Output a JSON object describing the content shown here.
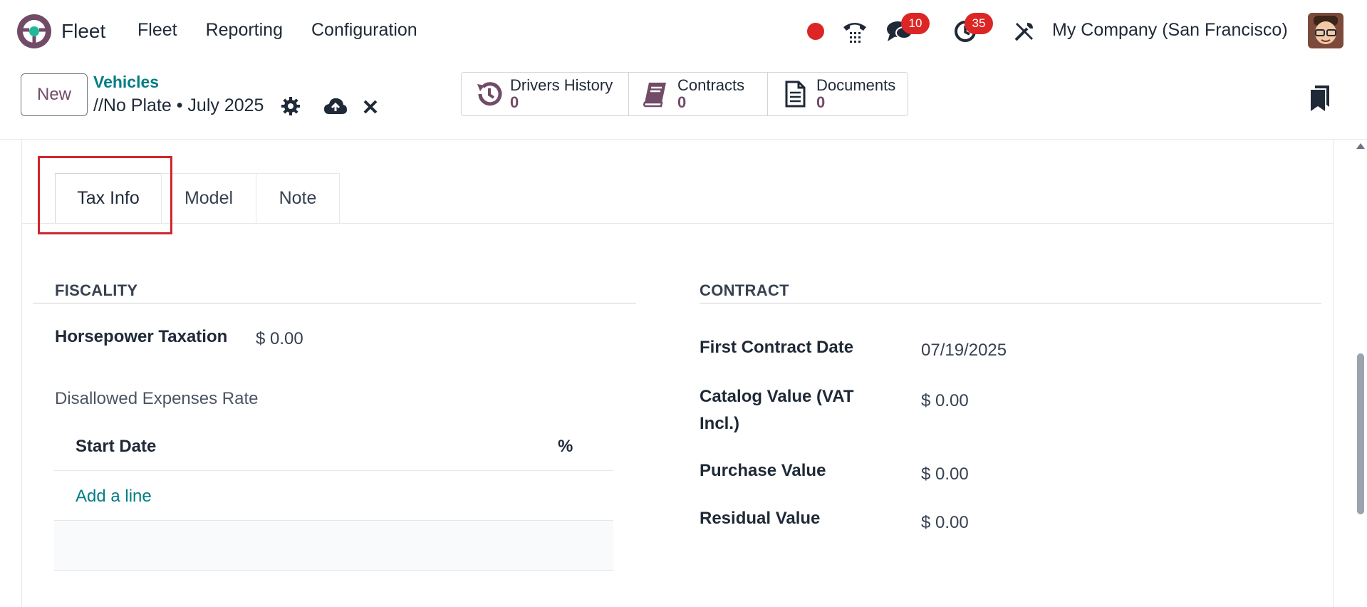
{
  "app": {
    "name": "Fleet",
    "menu": [
      "Fleet",
      "Reporting",
      "Configuration"
    ],
    "company": "My Company (San Francisco)",
    "chat_badge": "10",
    "activity_badge": "35"
  },
  "control_panel": {
    "new_label": "New",
    "breadcrumb_parent": "Vehicles",
    "breadcrumb_current": "//No Plate • July 2025",
    "stats": [
      {
        "label": "Drivers History",
        "value": "0"
      },
      {
        "label": "Contracts",
        "value": "0"
      },
      {
        "label": "Documents",
        "value": "0"
      }
    ]
  },
  "tabs": [
    "Tax Info",
    "Model",
    "Note"
  ],
  "fiscality": {
    "title": "FISCALITY",
    "horsepower_label": "Horsepower Taxation",
    "horsepower_value": "$ 0.00",
    "disallowed_label": "Disallowed Expenses Rate",
    "table_headers": [
      "Start Date",
      "%"
    ],
    "add_line": "Add a line"
  },
  "contract": {
    "title": "CONTRACT",
    "fields": [
      {
        "label": "First Contract Date",
        "value": "07/19/2025"
      },
      {
        "label": "Catalog Value (VAT Incl.)",
        "value": "$ 0.00"
      },
      {
        "label": "Purchase Value",
        "value": "$ 0.00"
      },
      {
        "label": "Residual Value",
        "value": "$ 0.00"
      }
    ]
  },
  "colors": {
    "brand": "#714b67",
    "link": "#017e84",
    "badge": "#dc2626",
    "highlight": "#d0262c"
  }
}
